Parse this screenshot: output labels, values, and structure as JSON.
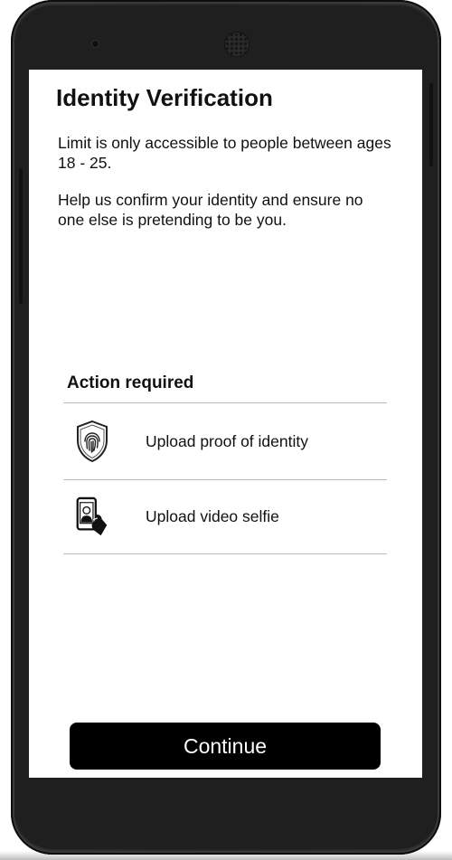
{
  "screen": {
    "title": "Identity Verification",
    "description_1": "Limit is only accessible to people between ages 18 - 25.",
    "description_2": "Help us confirm your identity and ensure no one else is pretending to be you."
  },
  "actions": {
    "heading": "Action required",
    "items": [
      {
        "label": "Upload proof of identity",
        "icon": "fingerprint-shield-icon"
      },
      {
        "label": "Upload video selfie",
        "icon": "phone-selfie-icon"
      }
    ]
  },
  "footer": {
    "continue_label": "Continue"
  },
  "colors": {
    "button_bg": "#000000",
    "button_text": "#ffffff",
    "divider": "#bdbdbd",
    "phone_body": "#262626"
  }
}
